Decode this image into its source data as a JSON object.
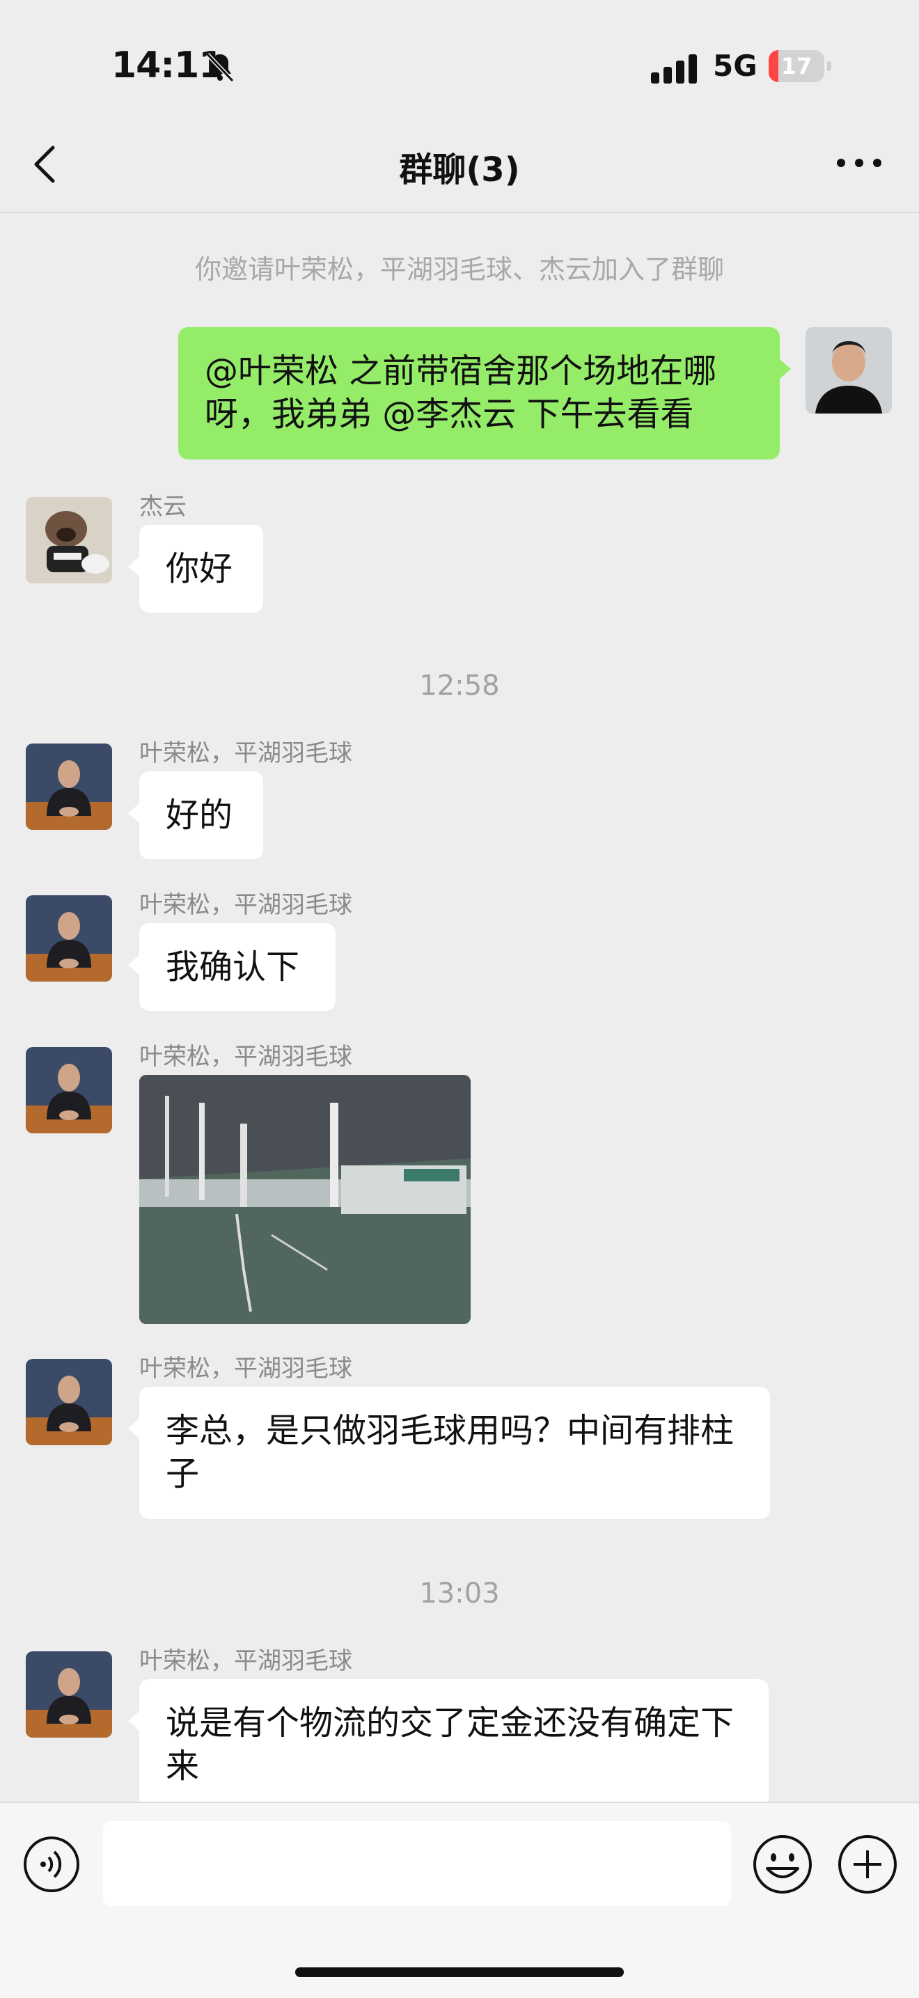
{
  "status_bar": {
    "time": "14:11",
    "network": "5G",
    "battery": "17",
    "battery_level": 0.17
  },
  "header": {
    "title": "群聊(3)"
  },
  "system_notice": "你邀请叶荣松，平湖羽毛球、杰云加入了群聊",
  "messages": [
    {
      "from": "me",
      "text": "@叶荣松 之前带宿舍那个场地在哪呀，我弟弟 @李杰云 下午去看看"
    },
    {
      "sender": "杰云",
      "text": "你好"
    },
    {
      "sender": "叶荣松，平湖羽毛球",
      "text": "好的"
    },
    {
      "sender": "叶荣松，平湖羽毛球",
      "text": "我确认下"
    },
    {
      "sender": "叶荣松，平湖羽毛球",
      "type": "image"
    },
    {
      "sender": "叶荣松，平湖羽毛球",
      "text": "李总，是只做羽毛球用吗？中间有排柱子"
    },
    {
      "sender": "叶荣松，平湖羽毛球",
      "text": "说是有个物流的交了定金还没有确定下来"
    }
  ],
  "timestamps": [
    "12:58",
    "13:03"
  ],
  "icons": {
    "back": "chevron-left-icon",
    "more": "more-icon",
    "voice": "voice-icon",
    "emoji": "emoji-icon",
    "plus": "plus-icon",
    "bell": "bell-muted-icon"
  },
  "colors": {
    "my_bubble": "#95ec69",
    "other_bubble": "#ffffff",
    "background": "#ededed"
  }
}
